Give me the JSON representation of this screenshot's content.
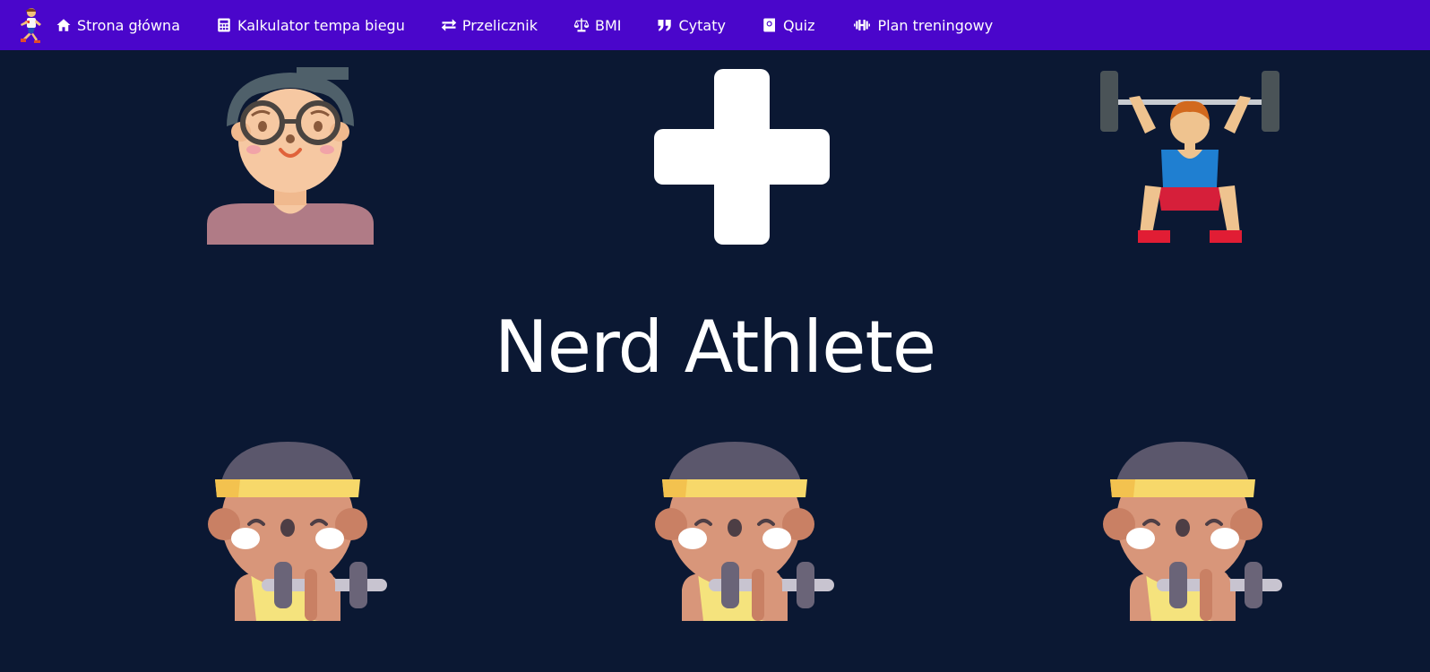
{
  "navbar": {
    "brand_icon": "runner-logo-icon",
    "items": [
      {
        "label": "Strona główna",
        "icon": "home-icon"
      },
      {
        "label": "Kalkulator tempa biegu",
        "icon": "calculator-icon"
      },
      {
        "label": "Przelicznik",
        "icon": "exchange-icon"
      },
      {
        "label": "BMI",
        "icon": "balance-scale-icon"
      },
      {
        "label": "Cytaty",
        "icon": "quote-icon"
      },
      {
        "label": "Quiz",
        "icon": "quiz-book-icon"
      },
      {
        "label": "Plan treningowy",
        "icon": "dumbbell-icon"
      }
    ]
  },
  "hero": {
    "title": "Nerd Athlete",
    "top_row": [
      "nerd-avatar-icon",
      "plus-icon",
      "weightlifter-icon"
    ],
    "bottom_row": [
      "athlete-with-dumbbell-icon",
      "athlete-with-dumbbell-icon",
      "athlete-with-dumbbell-icon"
    ]
  },
  "colors": {
    "navbar": "#4a06cb",
    "background": "#0b1833",
    "text": "#ffffff"
  }
}
